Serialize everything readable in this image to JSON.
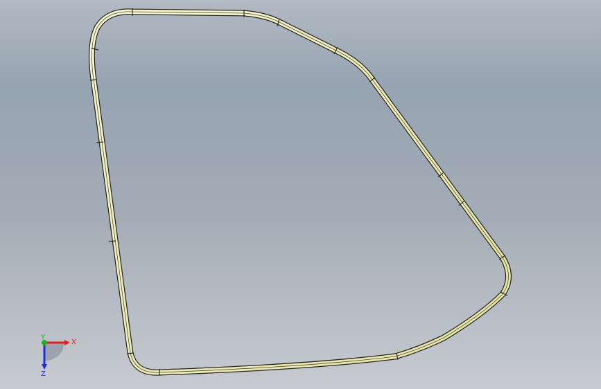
{
  "viewport": {
    "background_top": "#96a3b1",
    "background_bottom": "#c7cbd0",
    "part_color": "#f3f2c4",
    "part_edge_color": "#2a2a1c"
  },
  "triad": {
    "x_label": "X",
    "y_label": "Y",
    "z_label": "Z",
    "x_color": "#e02020",
    "y_color": "#20b020",
    "z_color": "#2030d0"
  }
}
